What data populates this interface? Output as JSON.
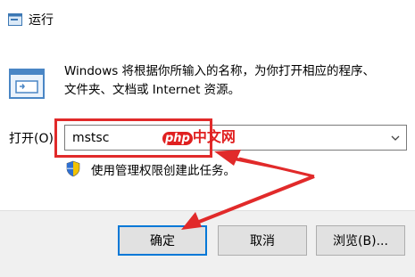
{
  "window": {
    "title": "运行",
    "icon": "run-window-icon"
  },
  "description": {
    "line1": "Windows 将根据你所输入的名称，为你打开相应的程序、",
    "line2": "文件夹、文档或 Internet 资源。",
    "icon": "run-icon"
  },
  "open_field": {
    "label": "打开(O):",
    "value": "mstsc"
  },
  "admin_note": {
    "text": "使用管理权限创建此任务。",
    "icon": "uac-shield-icon"
  },
  "watermark": {
    "brand": "php",
    "suffix": "中文网"
  },
  "buttons": {
    "ok": "确定",
    "cancel": "取消",
    "browse": "浏览(B)..."
  },
  "colors": {
    "annotation_red": "#e12a2a",
    "ok_button_border": "#0078d7",
    "footer_bg": "#f0f0f0"
  }
}
